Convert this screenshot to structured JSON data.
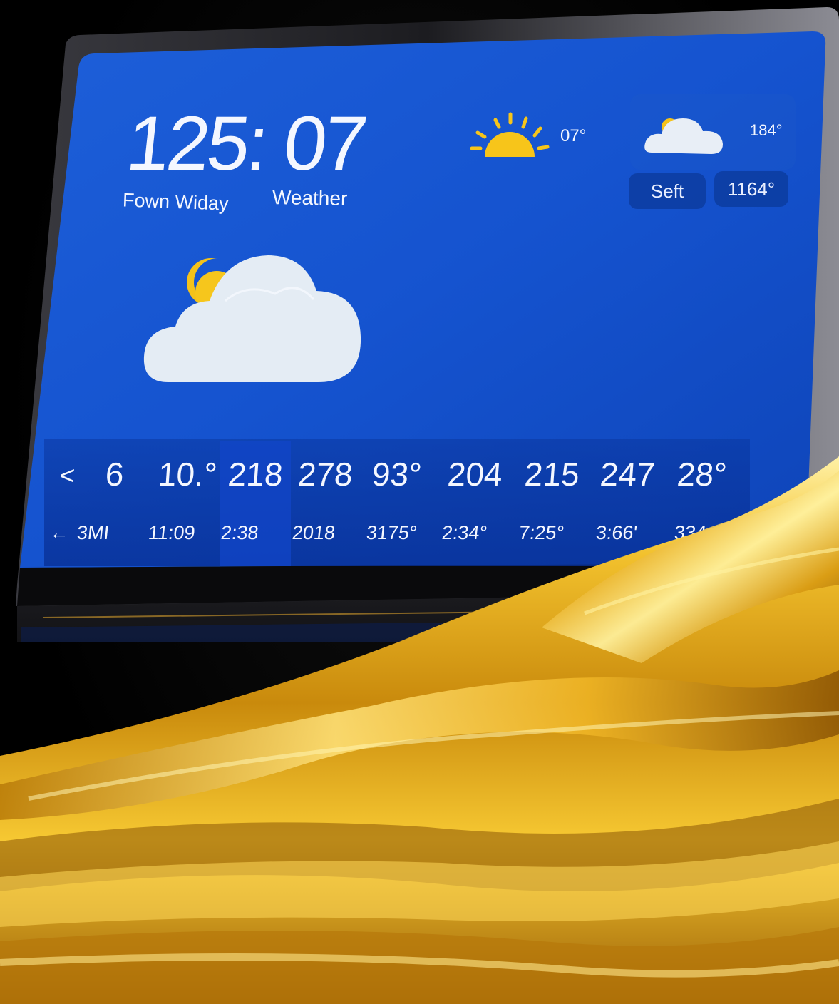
{
  "clock": {
    "time": "125: 07",
    "subtitle_left": "Fown Widay",
    "subtitle_right": "Weather"
  },
  "top_weather": {
    "sun_icon": "sun-icon",
    "sun_temp": "07°",
    "cloud_icon": "cloud-icon",
    "card_temp": "184°",
    "chip_a": "Seft",
    "chip_b": "1164°"
  },
  "main_icon": "partly-cloudy-icon",
  "forecast": {
    "row1": [
      "<",
      "6",
      "10.°",
      "218",
      "278",
      "93°",
      "204",
      "215",
      "247",
      "28°"
    ],
    "row2_arrow": "←",
    "row2": [
      "3MI",
      "11:09",
      "2:38",
      "2018",
      "3175°",
      "2:34°",
      "7:25°",
      "3:66'",
      "334"
    ]
  },
  "colors": {
    "screen_blue": "#1a5ad6",
    "gold": "#e6a817",
    "bezel": "#2a2a2e"
  }
}
